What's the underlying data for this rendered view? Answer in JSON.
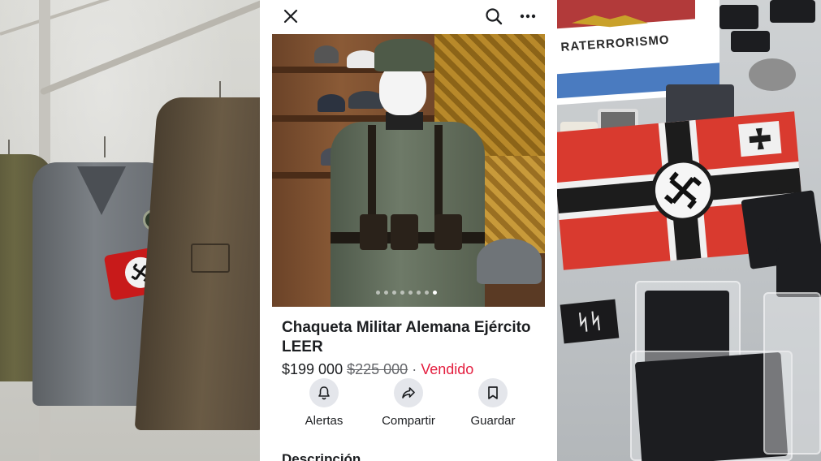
{
  "left_photo": {
    "subject": "uniform-jackets-photo"
  },
  "phone": {
    "topbar": {
      "close_icon": "close-icon",
      "search_icon": "search-icon",
      "more_icon": "more-icon"
    },
    "carousel": {
      "total_images": 8,
      "active_index": 7
    },
    "listing": {
      "title": "Chaqueta Militar Alemana Ejército LEER",
      "price": "$199 000",
      "original_price": "$225 000",
      "separator": "·",
      "status": "Vendido"
    },
    "actions": [
      {
        "label": "Alertas",
        "icon": "bell-icon"
      },
      {
        "label": "Compartir",
        "icon": "share-icon"
      },
      {
        "label": "Guardar",
        "icon": "bookmark-icon"
      }
    ],
    "description_heading": "Descripción",
    "colors": {
      "sold": "#e41e3f",
      "text": "#1c1e21",
      "muted": "#65676b",
      "action_bg": "#e4e6eb"
    }
  },
  "right_photo": {
    "banner_text": "RATERRORISMO"
  }
}
